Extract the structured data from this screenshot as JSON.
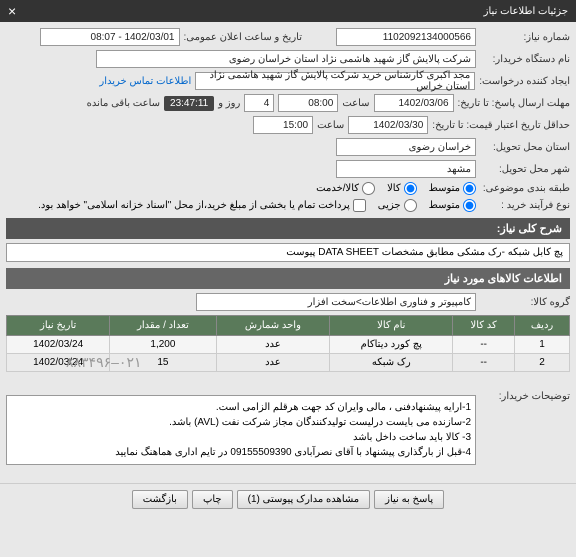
{
  "header": {
    "title": "جزئیات اطلاعات نیاز"
  },
  "fields": {
    "need_no_label": "شماره نیاز:",
    "need_no": "1102092134000566",
    "announce_label": "تاریخ و ساعت اعلان عمومی:",
    "announce": "1402/03/01 - 08:07",
    "buyer_label": "نام دستگاه خریدار:",
    "buyer": "شرکت پالایش گاز شهید هاشمی نژاد    استان خراسان رضوی",
    "creator_label": "ایجاد کننده درخواست:",
    "creator": "مجد اکبری کارشناس خرید شرکت پالایش گاز شهید هاشمی نژاد    استان خراس",
    "contact_link": "اطلاعات تماس خریدار",
    "deadline_label": "مهلت ارسال پاسخ: تا تاریخ:",
    "deadline_date": "1402/03/06",
    "deadline_time_label": "ساعت",
    "deadline_time": "08:00",
    "remain_day": "4",
    "remain_day_label": "روز و",
    "remain_time": "23:47:11",
    "remain_suffix": "ساعت باقی مانده",
    "credit_label": "حداقل تاریخ اعتبار قیمت: تا تاریخ:",
    "credit_date": "1402/03/30",
    "credit_time_label": "ساعت",
    "credit_time": "15:00",
    "province_label": "استان محل تحویل:",
    "province": "خراسان رضوی",
    "city_label": "شهر محل تحویل:",
    "city": "مشهد",
    "budget_label": "طبقه بندی موضوعی:",
    "budget_opt1": "متوسط",
    "budget_opt2": "کالا",
    "budget_opt3": "کالا/خدمت",
    "buytype_label": "نوع فرآیند خرید :",
    "buytype_opt1": "متوسط",
    "buytype_opt2": "جزیی",
    "buytype_note": "پرداخت تمام یا بخشی از مبلغ خرید،از محل \"اسناد خزانه اسلامی\" خواهد بود.",
    "summary_label": "شرح کلی نیاز:",
    "summary": "پچ کابل شبکه -رک مشکی مطابق مشخصات DATA SHEET پیوست",
    "items_title": "اطلاعات کالاهای مورد نیاز",
    "group_label": "گروه کالا:",
    "group": "کامپیوتر و فناوری اطلاعات>سخت افزار",
    "buyer_note_label": "توضیحات خریدار:",
    "buyer_note": "1-ارایه پیشنهادفنی ، مالی وایران کد جهت هرقلم الزامی است.\n2-سازنده می بایست درلیست تولیدکنندگان مجاز شرکت نفت (AVL)  باشد.\n3- کالا باید ساخت داخل باشد\n4-قبل از بارگذاری پیشنهاد با آقای نصرآبادی 09155509390 در تایم اداری هماهنگ نمایید"
  },
  "table": {
    "headers": [
      "ردیف",
      "کد کالا",
      "نام کالا",
      "واحد شمارش",
      "تعداد / مقدار",
      "تاریخ نیاز"
    ],
    "rows": [
      [
        "1",
        "--",
        "پچ کورد دیتاکام",
        "عدد",
        "1,200",
        "1402/03/24"
      ],
      [
        "2",
        "--",
        "رک شبکه",
        "عدد",
        "15",
        "1402/03/24"
      ]
    ],
    "phone_left": "۰۲۱–۸۸۳۴۹۶"
  },
  "buttons": {
    "reply": "پاسخ به نیاز",
    "attach": "مشاهده مدارک پیوستی (1)",
    "print": "چاپ",
    "back": "بازگشت"
  }
}
